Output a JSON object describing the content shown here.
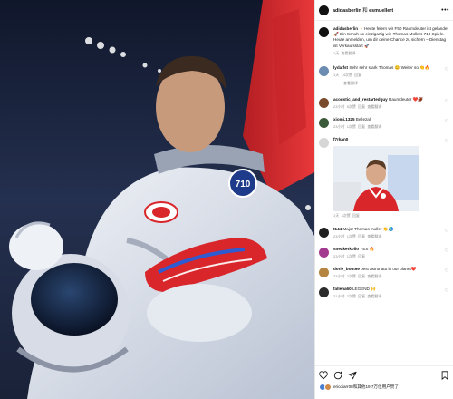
{
  "header": {
    "account": "adidasberlin",
    "connector": "和",
    "collaborator": "esmuellert"
  },
  "caption": {
    "user": "adidasberlin",
    "text": "🔸Heute feiern wir F50 Raumdeuter ist gelandet 🚀 Ein Schuh so einzigartig wie Thomas Müllers 710 Spiele. Heute anmelden, um dir deine Chance zu sichern – Dienstag ist Verkaufsstart 🚀",
    "time": "1天",
    "translate": "查看翻译"
  },
  "comments": [
    {
      "user": "lyda.fst",
      "text": "Sehr sehr stark Thomas 😊 Weiter so 👏🔥",
      "time": "1天",
      "likes": "14次赞",
      "reply": "回复",
      "translate": "查看翻译",
      "avatar": "#6b8bb0"
    },
    {
      "user": "acoustic_and_restartedguy",
      "text": "Raumdeuter ❤️🏈",
      "time": "23小时",
      "likes": "5次赞",
      "reply": "回复",
      "translate": "查看翻译",
      "avatar": "#7a4a2c"
    },
    {
      "user": "xiomi.1325",
      "text": "Bellezal",
      "time": "23小时",
      "likes": "1次赞",
      "reply": "回复",
      "translate": "查看翻译",
      "avatar": "#3a5a3a"
    },
    {
      "user": "f7rkan0_",
      "text": "",
      "time": "1天",
      "likes": "4次赞",
      "reply": "回复",
      "translate": "",
      "avatar": "#d6d6d6",
      "gif": true
    },
    {
      "user": "t144",
      "text": "Major Thomas muller 👏🌏",
      "time": "23小时",
      "likes": "1次赞",
      "reply": "回复",
      "translate": "查看翻译",
      "avatar": "#202020"
    },
    {
      "user": "sneakerkollo",
      "text": "YES 🔥",
      "time": "23小时",
      "likes": "1次赞",
      "reply": "回复",
      "translate": "",
      "avatar": "#a33a8f"
    },
    {
      "user": "dorie_bout99",
      "text": "best astronaut in our planet❤️",
      "time": "23小时",
      "likes": "2次赞",
      "reply": "回复",
      "translate": "查看翻译",
      "avatar": "#b48440"
    },
    {
      "user": "fallena60",
      "text": "LEGEND 🙌",
      "time": "21小时",
      "likes": "2次赞",
      "reply": "回复",
      "translate": "查看翻译",
      "avatar": "#2b2b2b"
    }
  ],
  "reply_thread": {
    "label": "查看回复 (1)"
  },
  "footer": {
    "likes_text": "ericdiarr08和其他19.7万位用户赞了"
  },
  "colors": {
    "sky": "#1a2340",
    "flag_red": "#d9262b",
    "accent_blue": "#0095f6"
  },
  "icons": [
    "heart-icon",
    "comment-icon",
    "share-icon",
    "bookmark-icon",
    "more-icon",
    "verified-icon"
  ]
}
